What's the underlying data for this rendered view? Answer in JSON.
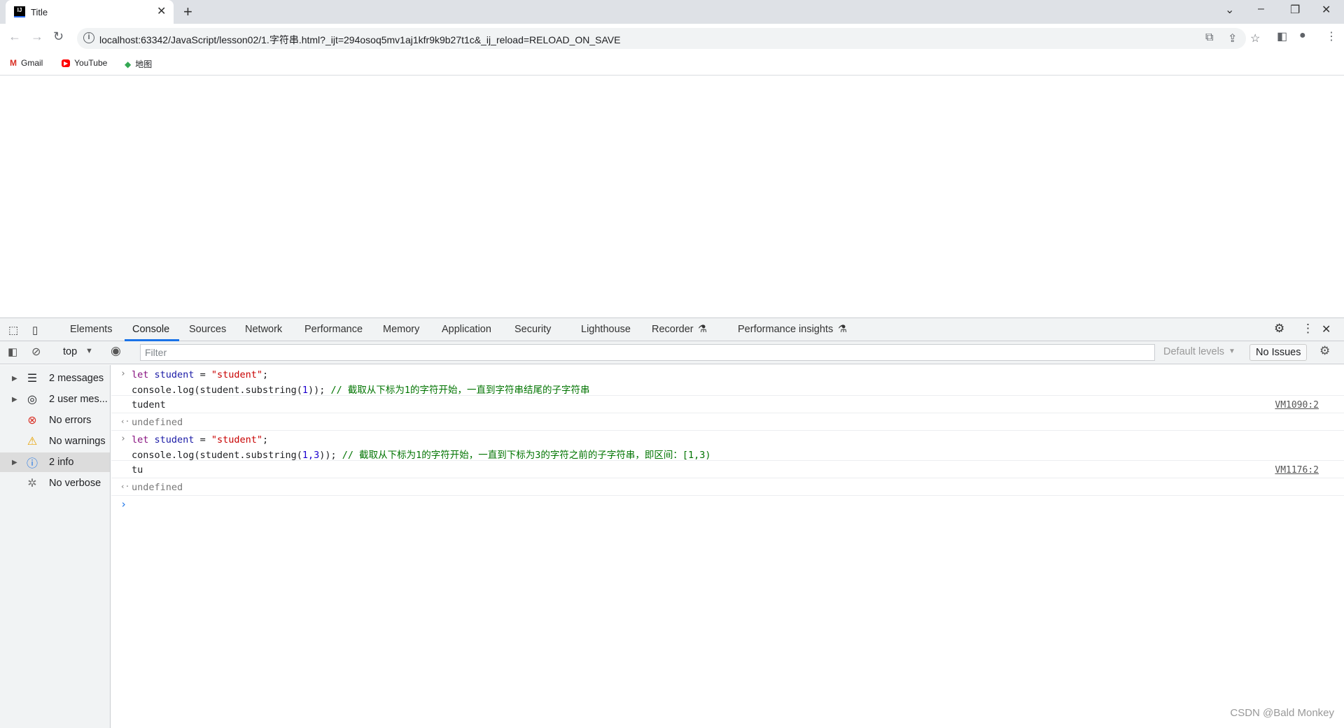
{
  "browser": {
    "tab_title": "Title",
    "favicon_text": "IJ",
    "url": "localhost:63342/JavaScript/lesson02/1.字符串.html?_ijt=294osoq5mv1aj1kfr9k9b27t1c&_ij_reload=RELOAD_ON_SAVE",
    "bookmarks": [
      {
        "label": "Gmail"
      },
      {
        "label": "YouTube"
      },
      {
        "label": "地图"
      }
    ]
  },
  "devtools": {
    "tabs": [
      {
        "label": "Elements"
      },
      {
        "label": "Console"
      },
      {
        "label": "Sources"
      },
      {
        "label": "Network"
      },
      {
        "label": "Performance"
      },
      {
        "label": "Memory"
      },
      {
        "label": "Application"
      },
      {
        "label": "Security"
      },
      {
        "label": "Lighthouse"
      },
      {
        "label": "Recorder"
      },
      {
        "label": "Performance insights"
      }
    ],
    "active_tab": "Console",
    "context": "top",
    "filter_placeholder": "Filter",
    "levels": "Default levels",
    "issues": "No Issues",
    "sidebar": [
      {
        "label": "2 messages",
        "icon": "list-icon"
      },
      {
        "label": "2 user mes...",
        "icon": "user-icon"
      },
      {
        "label": "No errors",
        "icon": "error-icon"
      },
      {
        "label": "No warnings",
        "icon": "warning-icon"
      },
      {
        "label": "2 info",
        "icon": "info-icon"
      },
      {
        "label": "No verbose",
        "icon": "bug-icon"
      }
    ],
    "console": [
      {
        "kw": "let",
        "var": "student",
        "eq": " = ",
        "str": "\"student\"",
        "semi": ";",
        "l2a": "console.log(student.substring(",
        "l2n": "1",
        "l2b": ")); ",
        "comment": "// 截取从下标为1的字符开始，一直到字符串结尾的子字符串",
        "output": "tudent",
        "source": "VM1090:2",
        "result": "undefined"
      },
      {
        "kw": "let",
        "var": "student",
        "eq": " = ",
        "str": "\"student\"",
        "semi": ";",
        "l2a": "console.log(student.substring(",
        "l2n": "1,3",
        "l2b": ")); ",
        "comment": "// 截取从下标为1的字符开始，一直到下标为3的字符之前的子字符串，即区间：[1,3)",
        "output": "tu",
        "source": "VM1176:2",
        "result": "undefined"
      }
    ]
  },
  "watermark": "CSDN @Bald Monkey"
}
